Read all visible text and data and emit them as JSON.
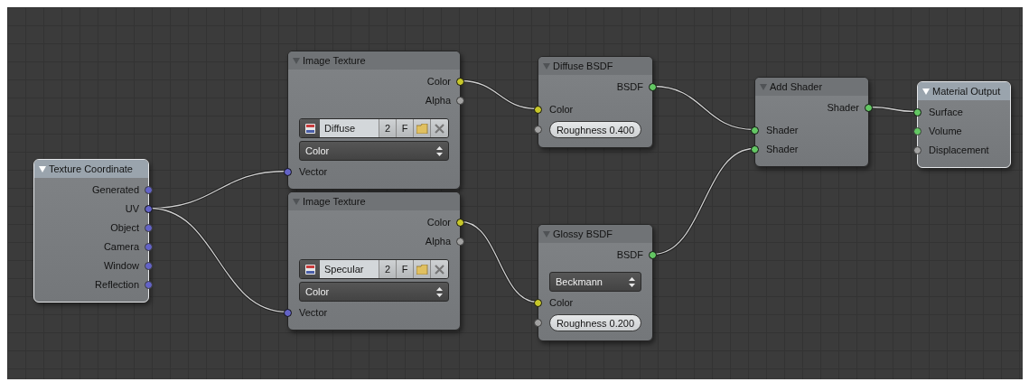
{
  "nodes": [
    {
      "title": "Texture Coordinate",
      "selected": true,
      "rows": [
        {
          "kind": "output",
          "label": "Generated",
          "color": "#6363c7",
          "linked": false
        },
        {
          "kind": "output",
          "label": "UV",
          "color": "#6363c7",
          "linked": true
        },
        {
          "kind": "output",
          "label": "Object",
          "color": "#6363c7",
          "linked": false
        },
        {
          "kind": "output",
          "label": "Camera",
          "color": "#6363c7",
          "linked": false
        },
        {
          "kind": "output",
          "label": "Window",
          "color": "#6363c7",
          "linked": false
        },
        {
          "kind": "output",
          "label": "Reflection",
          "color": "#6363c7",
          "linked": false
        }
      ]
    },
    {
      "title": "Image Texture",
      "selected": false,
      "rows": [
        {
          "kind": "output",
          "label": "Color",
          "color": "#c7c729",
          "linked": true
        },
        {
          "kind": "output",
          "label": "Alpha",
          "color": "#a1a1a1",
          "linked": false
        },
        {
          "kind": "image",
          "name": "Diffuse",
          "users": "2",
          "fake": "F"
        },
        {
          "kind": "dropdown",
          "value": "Color"
        },
        {
          "kind": "input",
          "label": "Vector",
          "color": "#6363c7",
          "linked": true
        }
      ]
    },
    {
      "title": "Image Texture",
      "selected": false,
      "rows": [
        {
          "kind": "output",
          "label": "Color",
          "color": "#c7c729",
          "linked": true
        },
        {
          "kind": "output",
          "label": "Alpha",
          "color": "#a1a1a1",
          "linked": false
        },
        {
          "kind": "image",
          "name": "Specular",
          "users": "2",
          "fake": "F"
        },
        {
          "kind": "dropdown",
          "value": "Color"
        },
        {
          "kind": "input",
          "label": "Vector",
          "color": "#6363c7",
          "linked": true
        }
      ]
    },
    {
      "title": "Diffuse BSDF",
      "selected": false,
      "rows": [
        {
          "kind": "output",
          "label": "BSDF",
          "color": "#63c763",
          "linked": true
        },
        {
          "kind": "input",
          "label": "Color",
          "color": "#c7c729",
          "linked": true
        },
        {
          "kind": "field",
          "label": "Roughness 0.400",
          "color": "#a1a1a1",
          "linked": false
        }
      ]
    },
    {
      "title": "Glossy BSDF",
      "selected": false,
      "rows": [
        {
          "kind": "output",
          "label": "BSDF",
          "color": "#63c763",
          "linked": true
        },
        {
          "kind": "dropdown",
          "value": "Beckmann"
        },
        {
          "kind": "input",
          "label": "Color",
          "color": "#c7c729",
          "linked": true
        },
        {
          "kind": "field",
          "label": "Roughness 0.200",
          "color": "#a1a1a1",
          "linked": false
        }
      ]
    },
    {
      "title": "Add Shader",
      "selected": false,
      "rows": [
        {
          "kind": "output",
          "label": "Shader",
          "color": "#63c763",
          "linked": true
        },
        {
          "kind": "input",
          "label": "Shader",
          "color": "#63c763",
          "linked": true
        },
        {
          "kind": "input",
          "label": "Shader",
          "color": "#63c763",
          "linked": true
        }
      ]
    },
    {
      "title": "Material Output",
      "selected": true,
      "rows": [
        {
          "kind": "input",
          "label": "Surface",
          "color": "#63c763",
          "linked": true
        },
        {
          "kind": "input",
          "label": "Volume",
          "color": "#63c763",
          "linked": false
        },
        {
          "kind": "input",
          "label": "Displacement",
          "color": "#a1a1a1",
          "linked": false
        }
      ]
    }
  ]
}
